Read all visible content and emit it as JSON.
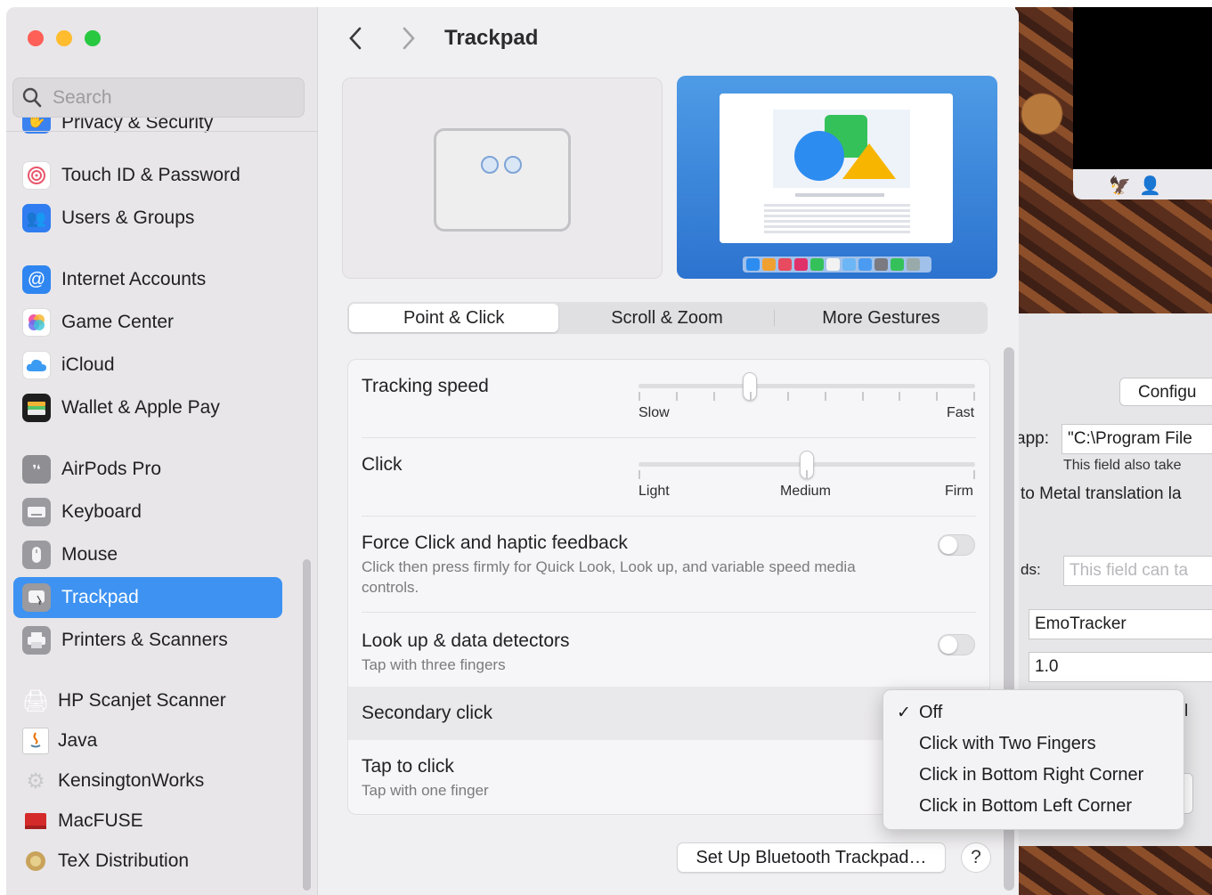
{
  "window": {
    "title": "Trackpad"
  },
  "search": {
    "placeholder": "Search"
  },
  "sidebar": {
    "items": [
      {
        "label": "Privacy & Security"
      },
      {
        "label": "Touch ID & Password"
      },
      {
        "label": "Users & Groups"
      },
      {
        "label": "Internet Accounts"
      },
      {
        "label": "Game Center"
      },
      {
        "label": "iCloud"
      },
      {
        "label": "Wallet & Apple Pay"
      },
      {
        "label": "AirPods Pro"
      },
      {
        "label": "Keyboard"
      },
      {
        "label": "Mouse"
      },
      {
        "label": "Trackpad"
      },
      {
        "label": "Printers & Scanners"
      },
      {
        "label": "HP Scanjet Scanner"
      },
      {
        "label": "Java"
      },
      {
        "label": "KensingtonWorks"
      },
      {
        "label": "MacFUSE"
      },
      {
        "label": "TeX Distribution"
      }
    ],
    "selected": "Trackpad"
  },
  "tabs": [
    {
      "label": "Point & Click",
      "selected": true
    },
    {
      "label": "Scroll & Zoom",
      "selected": false
    },
    {
      "label": "More Gestures",
      "selected": false
    }
  ],
  "settings": {
    "tracking_speed": {
      "title": "Tracking speed",
      "min_label": "Slow",
      "max_label": "Fast",
      "value": 0.33
    },
    "click": {
      "title": "Click",
      "labels": [
        "Light",
        "Medium",
        "Firm"
      ],
      "value": "Medium"
    },
    "force_click": {
      "title": "Force Click and haptic feedback",
      "desc": "Click then press firmly for Quick Look, Look up, and variable speed media controls.",
      "enabled": false
    },
    "look_up": {
      "title": "Look up & data detectors",
      "desc": "Tap with three fingers",
      "enabled": false
    },
    "secondary_click": {
      "title": "Secondary click"
    },
    "tap_to_click": {
      "title": "Tap to click",
      "desc": "Tap with one finger"
    }
  },
  "buttons": {
    "setup_bluetooth": "Set Up Bluetooth Trackpad…",
    "help": "?"
  },
  "secondary_click_menu": {
    "checkmark": "✓",
    "options": [
      "Off",
      "Click with Two Fingers",
      "Click in Bottom Right Corner",
      "Click in Bottom Left Corner"
    ],
    "selected": "Off"
  },
  "background_app": {
    "configure_button": "Configu",
    "app_label": "app:",
    "app_value": "\"C:\\Program File",
    "app_hint": "This field also take",
    "metal_text": "to Metal translation la",
    "args_label": "ds:",
    "args_placeholder": "This field can ta",
    "name_value": "EmoTracker",
    "version_value": "1.0",
    "cut_char": "l"
  },
  "colors": {
    "accent": "#3d92f2",
    "sidebar_bg": "#e8e6e9",
    "main_bg": "#f0eff1"
  }
}
